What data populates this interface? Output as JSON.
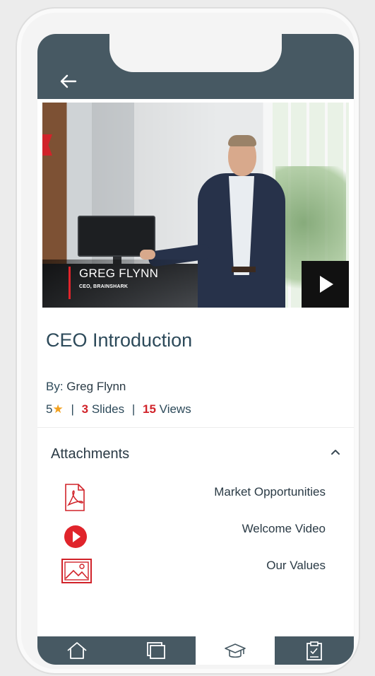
{
  "video": {
    "presenter_name": "GREG FLYNN",
    "presenter_role": "CEO, BRAINSHARK"
  },
  "presentation": {
    "title": "CEO Introduction",
    "by_label": "By:",
    "author": "Greg Flynn",
    "rating": "5",
    "slides_count": "3",
    "slides_label": "Slides",
    "views_count": "15",
    "views_label": "Views"
  },
  "attachments": {
    "header": "Attachments",
    "items": [
      {
        "label": "Market Opportunities",
        "icon": "pdf-icon"
      },
      {
        "label": "Welcome Video",
        "icon": "play-circle-icon"
      },
      {
        "label": "Our Values",
        "icon": "image-icon"
      }
    ]
  },
  "nav": {
    "items": [
      {
        "icon": "home-icon",
        "active": false
      },
      {
        "icon": "windows-icon",
        "active": false
      },
      {
        "icon": "graduation-cap-icon",
        "active": true
      },
      {
        "icon": "clipboard-icon",
        "active": false
      }
    ]
  },
  "colors": {
    "header": "#475963",
    "accent_red": "#d1232a",
    "star": "#f2a01e",
    "title_text": "#2d4a5a"
  }
}
